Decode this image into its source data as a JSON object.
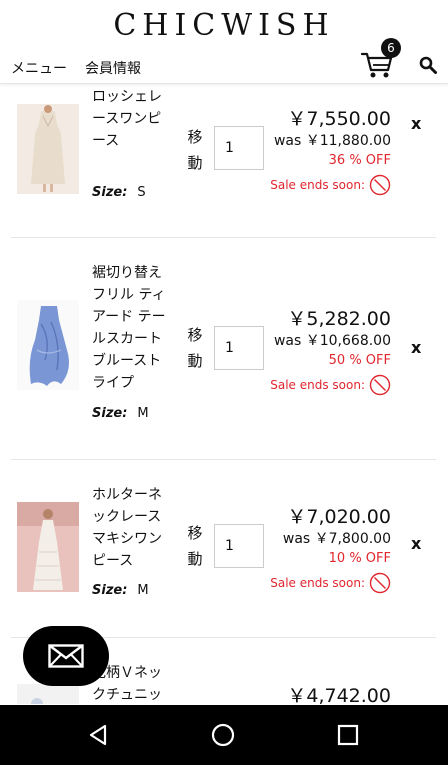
{
  "header": {
    "logo": "CHICWISH",
    "nav": {
      "menu": "メニュー",
      "member": "会員情報"
    },
    "cart_count": "6",
    "icons": {
      "cart": "cart-icon",
      "search": "search-icon"
    }
  },
  "items": [
    {
      "name": "Ｖネッククロッシェレースワンピース",
      "size_label": "Size:",
      "size": "S",
      "move_label": "移動",
      "quantity": "1",
      "price": "￥7,550.00",
      "was_price": "was ￥11,880.00",
      "discount": "36 % OFF",
      "sale_note": "Sale ends soon:",
      "remove": "x"
    },
    {
      "name": "裾切り替えフリル ティアード テールスカート ブルーストライプ",
      "size_label": "Size:",
      "size": "M",
      "move_label": "移動",
      "quantity": "1",
      "price": "￥5,282.00",
      "was_price": "was ￥10,668.00",
      "discount": "50 % OFF",
      "sale_note": "Sale ends soon:",
      "remove": "x"
    },
    {
      "name": "ホルターネックレースマキシワンピース",
      "size_label": "Size:",
      "size": "M",
      "move_label": "移動",
      "quantity": "1",
      "price": "￥7,020.00",
      "was_price": "was ￥7,800.00",
      "discount": "10 % OFF",
      "sale_note": "Sale ends soon:",
      "remove": "x"
    },
    {
      "name": "花柄Ｖネックチュニッ",
      "price": "￥4,742.00"
    }
  ],
  "colors": {
    "sale_red": "#e0262e",
    "fab_bg": "#000000"
  },
  "system_nav": {
    "back": "back-icon",
    "home": "home-icon",
    "recents": "recents-icon"
  }
}
